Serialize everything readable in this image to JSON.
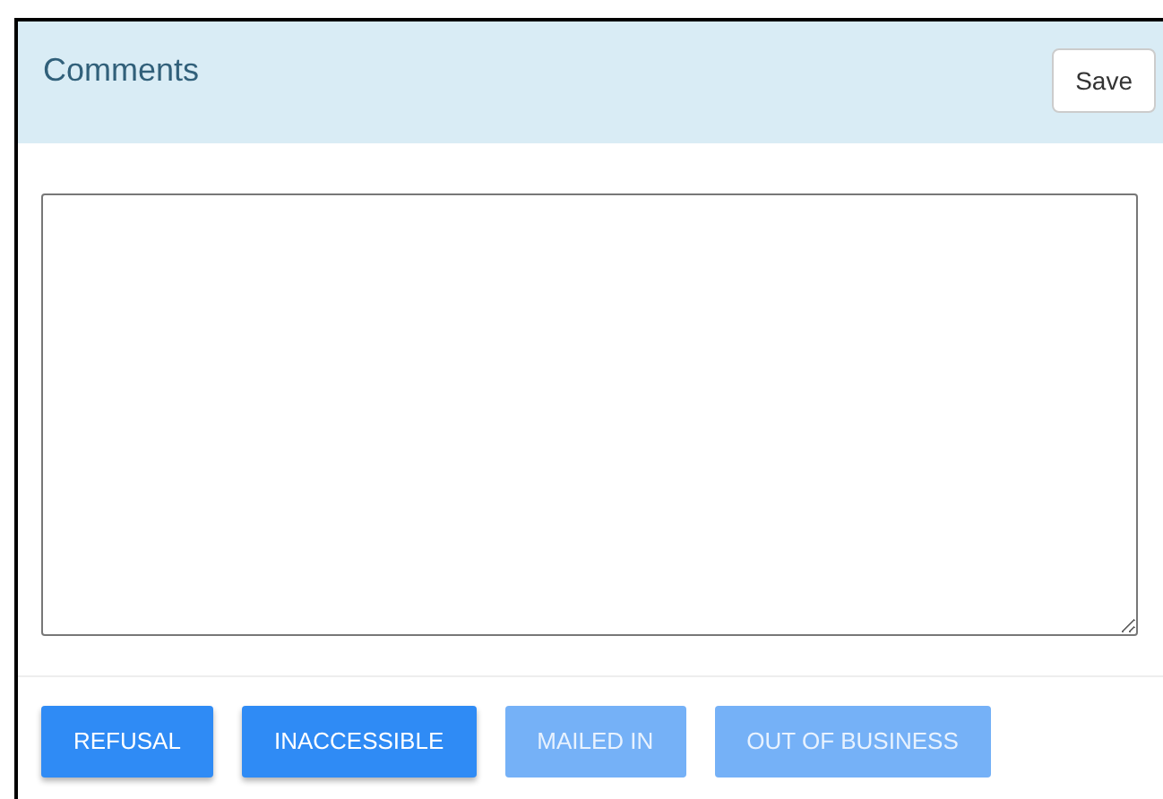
{
  "panel": {
    "title": "Comments",
    "save_button": "Save"
  },
  "actions": [
    {
      "label": "REFUSAL",
      "disabled": false
    },
    {
      "label": "INACCESSIBLE",
      "disabled": false
    },
    {
      "label": "MAILED IN",
      "disabled": true
    },
    {
      "label": "OUT OF BUSINESS",
      "disabled": true
    }
  ]
}
